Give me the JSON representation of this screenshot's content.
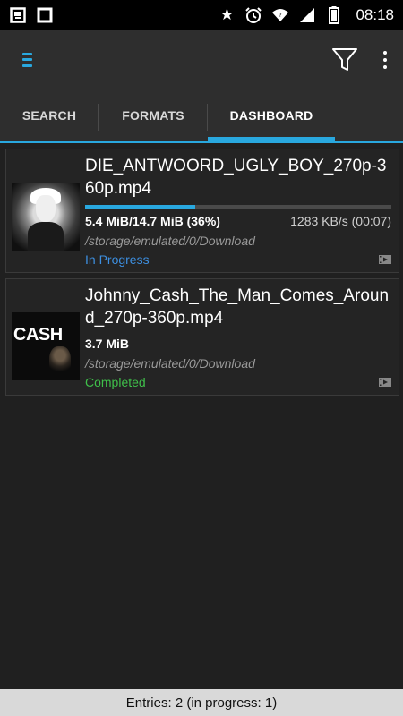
{
  "status_bar": {
    "left_icons": [
      "screenshot-icon",
      "square-icon"
    ],
    "right_icons": [
      "star-icon",
      "alarm-icon",
      "wifi-icon",
      "signal-icon",
      "battery-icon"
    ],
    "time": "08:18"
  },
  "toolbar": {
    "menu_icon": "menu-icon",
    "filter_icon": "filter-icon",
    "more_icon": "more-vert-icon"
  },
  "tabs": [
    {
      "label": "SEARCH"
    },
    {
      "label": "FORMATS"
    },
    {
      "label": "DASHBOARD"
    }
  ],
  "active_tab": "DASHBOARD",
  "downloads": [
    {
      "filename": "DIE_ANTWOORD_UGLY_BOY_270p-360p.mp4",
      "size": "5.4 MiB/14.7 MiB (36%)",
      "speed": "1283 KB/s (00:07)",
      "progress": 0.36,
      "path": "/storage/emulated/0/Download",
      "status": "In Progress"
    },
    {
      "filename": "Johnny_Cash_The_Man_Comes_Around_270p-360p.mp4",
      "size": "3.7 MiB",
      "path": "/storage/emulated/0/Download",
      "status": "Completed",
      "thumb_text": "CASH"
    }
  ],
  "footer": {
    "text": "Entries: 2 (in progress: 1)"
  },
  "colors": {
    "accent": "#29a8df",
    "in_progress": "#3d8fe0",
    "completed": "#3fbf4a"
  }
}
